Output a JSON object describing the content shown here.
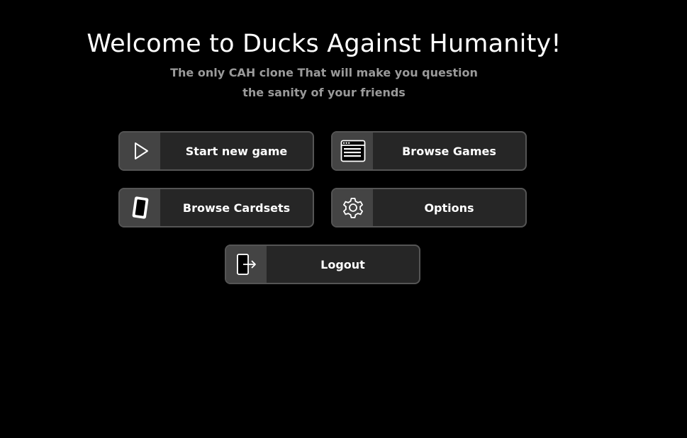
{
  "header": {
    "title": "Welcome to Ducks Against Humanity!",
    "subtitle": "The only CAH clone That will make you question the sanity of your friends"
  },
  "menu": {
    "start_new_game": {
      "label": "Start new game",
      "icon": "play-icon"
    },
    "browse_games": {
      "label": "Browse Games",
      "icon": "browser-window-icon"
    },
    "browse_cardsets": {
      "label": "Browse Cardsets",
      "icon": "card-icon"
    },
    "options": {
      "label": "Options",
      "icon": "gear-icon"
    },
    "logout": {
      "label": "Logout",
      "icon": "logout-icon"
    }
  },
  "colors": {
    "background": "#000000",
    "button_bg": "#262626",
    "icon_bg": "#444444",
    "button_border": "#555555",
    "subtitle": "#9a9a9a"
  }
}
